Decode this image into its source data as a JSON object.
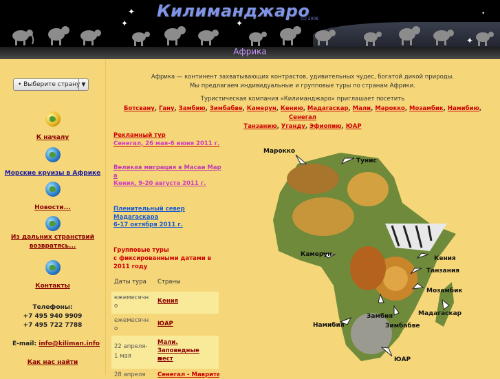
{
  "header": {
    "logo": "Килиманджаро",
    "logo_sub": "(C) 2008",
    "page_title": "Африка"
  },
  "country_select": {
    "selected": "• Выберите страну",
    "arrow": "▼"
  },
  "nav": [
    {
      "label": "К началу"
    },
    {
      "label": "Морские круизы в Африке"
    },
    {
      "label": "Новости..."
    },
    {
      "label_1": "Из дальних странствий",
      "label_2": "возвратясь..."
    },
    {
      "label": "Контакты"
    }
  ],
  "contacts": {
    "phones_label": "Телефоны:",
    "phone_1": "+7 495 940 9909",
    "phone_2": "+7 495 722 7788",
    "email_label": "E-mail:",
    "email": "info@kiliman.info",
    "howto": "Как нас найти"
  },
  "intro": {
    "line_1": "Африка — континент захватывающих контрастов, удивительных чудес, богатой дикой природы.",
    "line_2": "Мы предлагаем индивидуальные и групповые туры по странам Африки.",
    "line_3": "Туристическая компания «Килиманджаро» приглашает посетить"
  },
  "countries_row1": [
    "Ботсвану",
    "Гану",
    "Замбию",
    "Зимбабве",
    "Камерун",
    "Кению",
    "Мадагаскар",
    "Мали",
    "Марокко",
    "Мозамбик",
    "Намибию",
    "Сенегал"
  ],
  "countries_row2": [
    "Танзанию",
    "Уганду",
    "Эфиопию",
    "ЮАР"
  ],
  "tours": [
    {
      "title": "Рекламный тур",
      "dates": "Сенегал, 26 мая-6 июня 2011 г."
    },
    {
      "title": "Великая миграция в Масаи Мар",
      "title_2": "а",
      "dates": "Кения, 9-20 августа 2011 г."
    },
    {
      "title": "Пленительный север",
      "title_2": "Мадагаскара",
      "dates": "6-17 октября 2011 г."
    }
  ],
  "group_tours": {
    "line_1": "Групповые туры",
    "line_2": "с фиксированными датами в",
    "line_3": "2011 году",
    "col_dates": "Даты тура",
    "col_countries": "Страны",
    "rows": [
      {
        "date_1": "ежемесячн",
        "date_2": "о",
        "country": "Кения"
      },
      {
        "date_1": "ежемесячн",
        "date_2": "о",
        "country": "ЮАР"
      },
      {
        "date_1": "22 апреля-",
        "date_2": "1 мая",
        "country": "Мали.",
        "country_2": "Заповедные мест",
        "country_3": "а"
      },
      {
        "date_1": "28 апреля",
        "country": "Сенегал - Мавритания"
      }
    ]
  },
  "map": {
    "labels": [
      "Марокко",
      "Тунис",
      "Камерун",
      "Кения",
      "Танзания",
      "Мозамбик",
      "Мадагаскар",
      "Замбия",
      "Зимбабве",
      "Намибия",
      "ЮАР"
    ],
    "colors": {
      "land": "#6e8a3a",
      "lion": "#c9852a",
      "sea": "#f5d77a"
    }
  },
  "colors": {
    "background": "#f5d77a",
    "link_red": "#cc0000",
    "link_dark": "#8a0000",
    "date_pink": "#d03cc0",
    "tour_blue": "#1a5bd0"
  }
}
